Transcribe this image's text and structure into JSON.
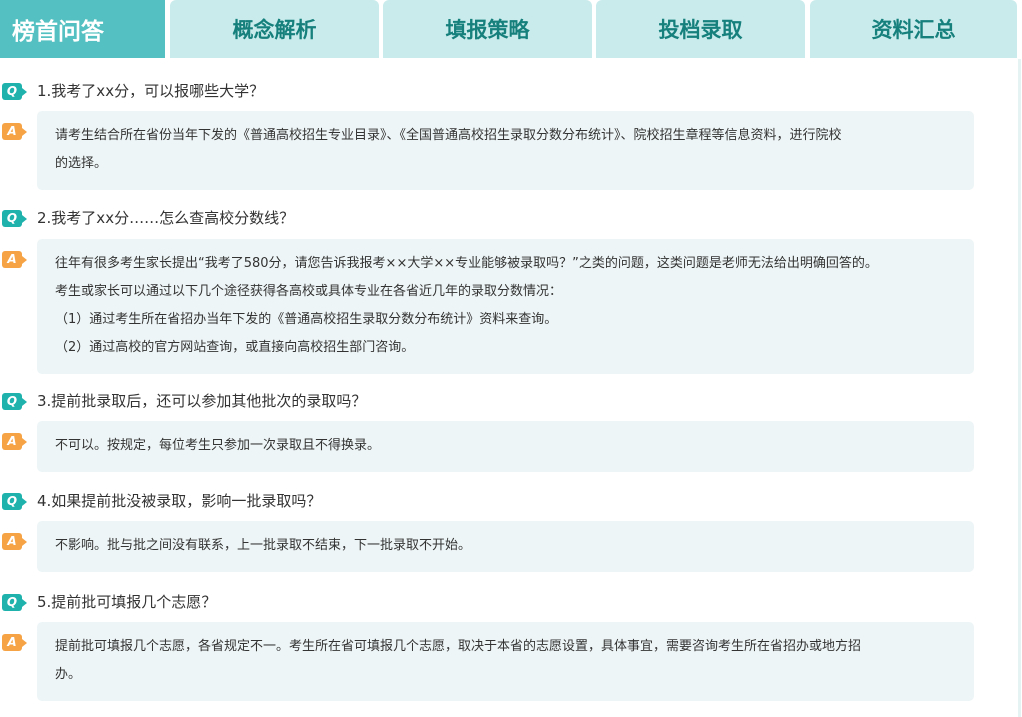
{
  "tabs": [
    {
      "label": "榜首问答",
      "active": true
    },
    {
      "label": "概念解析",
      "active": false
    },
    {
      "label": "填报策略",
      "active": false
    },
    {
      "label": "投档录取",
      "active": false
    },
    {
      "label": "资料汇总",
      "active": false
    }
  ],
  "icons": {
    "question": "Q",
    "answer": "A"
  },
  "colors": {
    "tab_active_bg": "#55c0c1",
    "tab_bg": "#c9ebec",
    "tab_text": "#16807d",
    "question_icon": "#1fb2ad",
    "answer_icon": "#f5a344",
    "answer_bg": "#eef5f6"
  },
  "faq": [
    {
      "question": "1.我考了xx分，可以报哪些大学？",
      "answer": [
        "请考生结合所在省份当年下发的《普通高校招生专业目录》、《全国普通高校招生录取分数分布统计》、院校招生章程等信息资料，进行院校",
        "的选择。"
      ]
    },
    {
      "question": "2.我考了xx分……怎么查高校分数线？",
      "answer": [
        "往年有很多考生家长提出“我考了580分，请您告诉我报考××大学××专业能够被录取吗？”之类的问题，这类问题是老师无法给出明确回答的。",
        "考生或家长可以通过以下几个途径获得各高校或具体专业在各省近几年的录取分数情况：",
        "（1）通过考生所在省招办当年下发的《普通高校招生录取分数分布统计》资料来查询。",
        "（2）通过高校的官方网站查询，或直接向高校招生部门咨询。"
      ]
    },
    {
      "question": "3.提前批录取后，还可以参加其他批次的录取吗？",
      "answer": [
        "不可以。按规定，每位考生只参加一次录取且不得换录。"
      ]
    },
    {
      "question": "4.如果提前批没被录取，影响一批录取吗？",
      "answer": [
        "不影响。批与批之间没有联系，上一批录取不结束，下一批录取不开始。"
      ]
    },
    {
      "question": "5.提前批可填报几个志愿？",
      "answer": [
        "提前批可填报几个志愿，各省规定不一。考生所在省可填报几个志愿，取决于本省的志愿设置，具体事宜，需要咨询考生所在省招办或地方招",
        "办。"
      ]
    }
  ]
}
